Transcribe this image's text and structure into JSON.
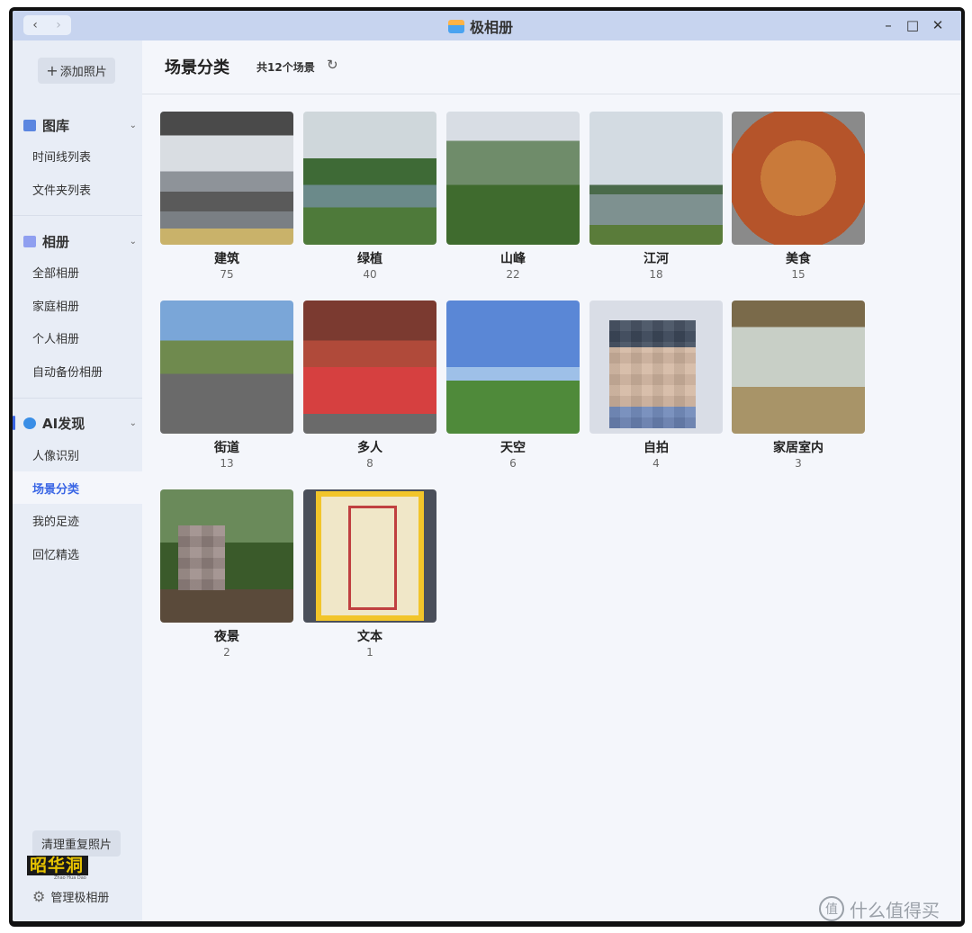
{
  "window": {
    "title": "极相册",
    "back_icon": "‹",
    "forward_icon": "›",
    "minimize_icon": "–",
    "maximize_icon": "□",
    "close_icon": "✕"
  },
  "sidebar": {
    "add_photo": "添加照片",
    "sections": [
      {
        "title": "图库",
        "items": [
          "时间线列表",
          "文件夹列表"
        ]
      },
      {
        "title": "相册",
        "items": [
          "全部相册",
          "家庭相册",
          "个人相册",
          "自动备份相册"
        ]
      },
      {
        "title": "AI发现",
        "items": [
          "人像识别",
          "场景分类",
          "我的足迹",
          "回忆精选"
        ]
      }
    ],
    "active_item": "场景分类",
    "dedup_button": "清理重复照片",
    "logo_text": "昭华洞",
    "logo_subtext": "Zhao Hua Dao",
    "manage_label": "管理极相册"
  },
  "main": {
    "title": "场景分类",
    "count_label": "共12个场景",
    "scenes": [
      {
        "name": "建筑",
        "count": "75"
      },
      {
        "name": "绿植",
        "count": "40"
      },
      {
        "name": "山峰",
        "count": "22"
      },
      {
        "name": "江河",
        "count": "18"
      },
      {
        "name": "美食",
        "count": "15"
      },
      {
        "name": "街道",
        "count": "13"
      },
      {
        "name": "多人",
        "count": "8"
      },
      {
        "name": "天空",
        "count": "6"
      },
      {
        "name": "自拍",
        "count": "4"
      },
      {
        "name": "家居室内",
        "count": "3"
      },
      {
        "name": "夜景",
        "count": "2"
      },
      {
        "name": "文本",
        "count": "1"
      }
    ]
  },
  "watermark": {
    "text": "什么值得买",
    "mark": "值"
  },
  "colors": {
    "accent": "#3a66e5",
    "titlebar": "#c7d4ef",
    "sidebar": "#e8edf6",
    "main": "#f4f6fb"
  }
}
